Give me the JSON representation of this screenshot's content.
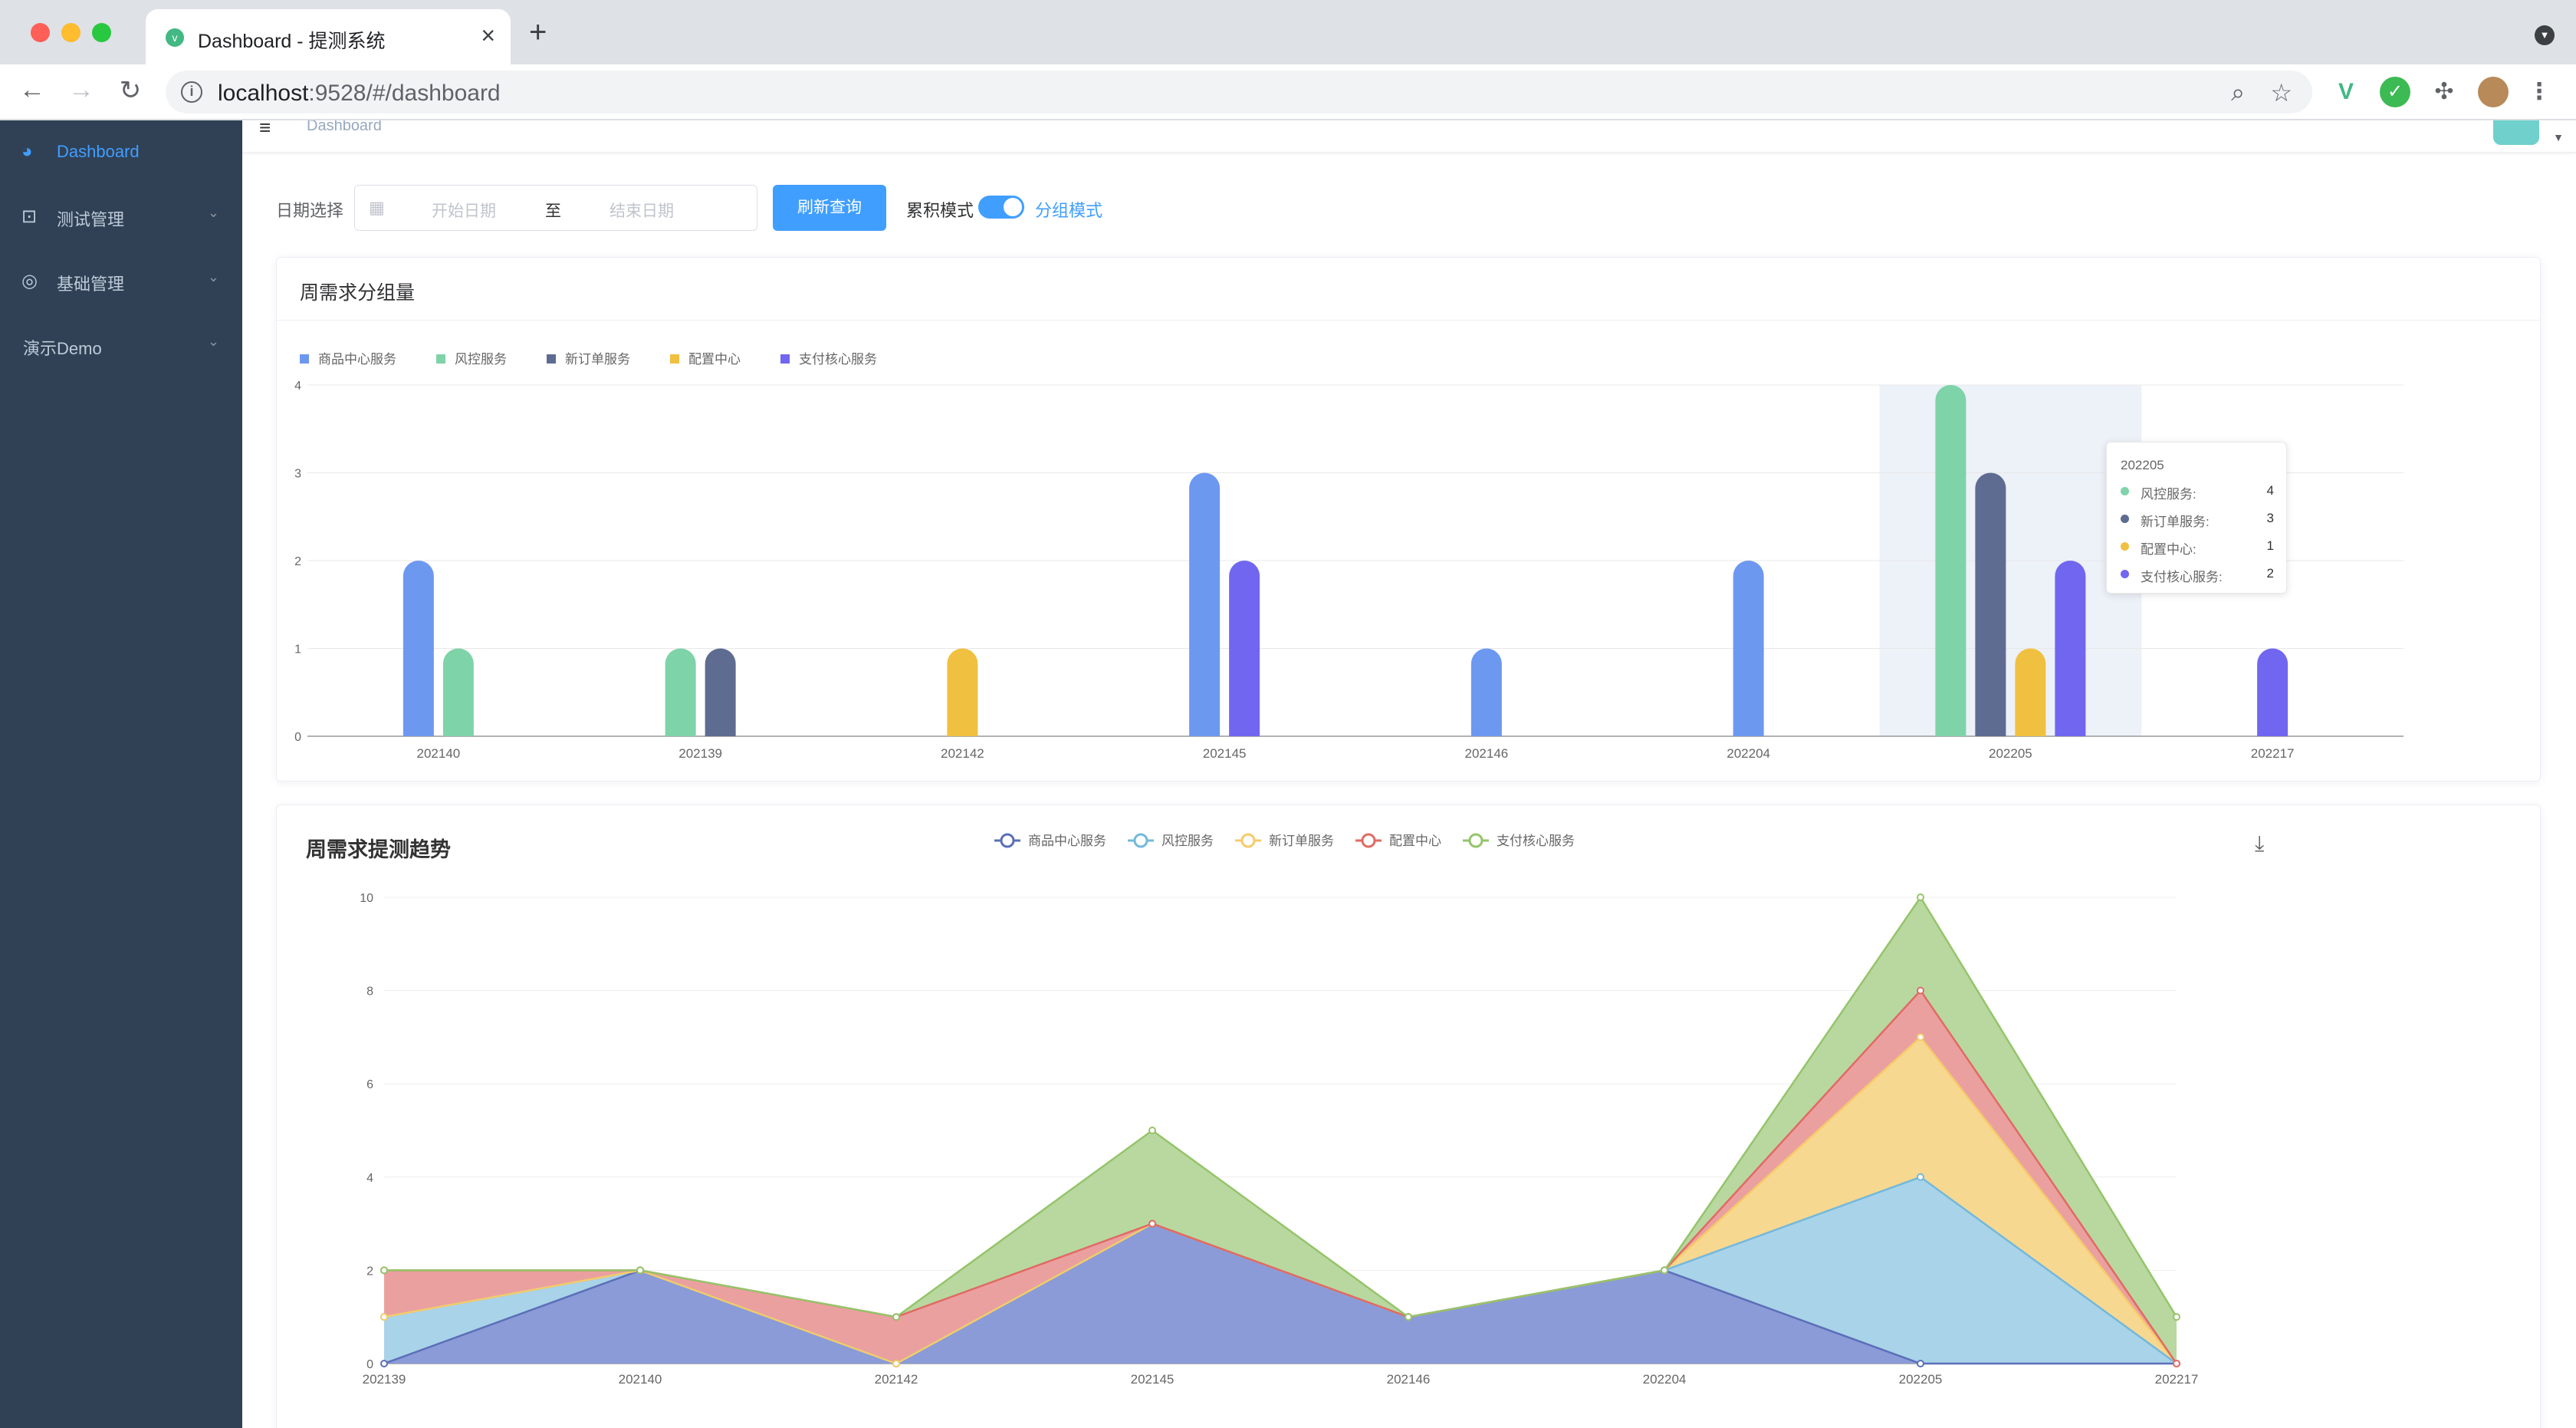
{
  "browser": {
    "tab_title": "Dashboard - 提测系统",
    "url_host": "localhost",
    "url_rest": ":9528/#/dashboard"
  },
  "sidebar": {
    "items": [
      {
        "label": "Dashboard",
        "icon": "dashboard-icon",
        "active": true
      },
      {
        "label": "测试管理",
        "icon": "chart-icon",
        "active": false
      },
      {
        "label": "基础管理",
        "icon": "settings-icon",
        "active": false
      },
      {
        "label": "演示Demo",
        "icon": "",
        "active": false
      }
    ]
  },
  "navbar": {
    "breadcrumb": "Dashboard"
  },
  "filters": {
    "date_label": "日期选择",
    "start_placeholder": "开始日期",
    "range_separator": "至",
    "end_placeholder": "结束日期",
    "refresh_button": "刷新查询",
    "mode_off_label": "累积模式",
    "mode_on_label": "分组模式",
    "grouped_mode_on": true
  },
  "colors": {
    "primary": "#409eff",
    "sidebar_bg": "#304156"
  },
  "card1": {
    "title": "周需求分组量"
  },
  "card2": {
    "title": "周需求提测趋势"
  },
  "tooltip": {
    "header": "202205",
    "rows": [
      {
        "name": "风控服务:",
        "value": "4",
        "color": "#7fd3a8"
      },
      {
        "name": "新订单服务:",
        "value": "3",
        "color": "#5e6c92"
      },
      {
        "name": "配置中心:",
        "value": "1",
        "color": "#f0c040"
      },
      {
        "name": "支付核心服务:",
        "value": "2",
        "color": "#7166f0"
      }
    ]
  },
  "chart_data": [
    {
      "type": "bar",
      "title": "周需求分组量",
      "categories": [
        "202140",
        "202139",
        "202142",
        "202145",
        "202146",
        "202204",
        "202205",
        "202217"
      ],
      "series": [
        {
          "name": "商品中心服务",
          "color": "#6d98f0",
          "values": [
            2,
            0,
            0,
            3,
            1,
            2,
            0,
            0
          ]
        },
        {
          "name": "风控服务",
          "color": "#7fd3a8",
          "values": [
            1,
            1,
            0,
            0,
            0,
            0,
            4,
            0
          ]
        },
        {
          "name": "新订单服务",
          "color": "#5e6c92",
          "values": [
            0,
            1,
            0,
            0,
            0,
            0,
            3,
            0
          ]
        },
        {
          "name": "配置中心",
          "color": "#f0c040",
          "values": [
            0,
            0,
            1,
            0,
            0,
            0,
            1,
            0
          ]
        },
        {
          "name": "支付核心服务",
          "color": "#7166f0",
          "values": [
            0,
            0,
            0,
            2,
            0,
            0,
            2,
            1
          ]
        }
      ],
      "ylim": [
        0,
        4
      ],
      "yticks": [
        "0",
        "1",
        "2",
        "3",
        "4"
      ],
      "highlight_category": "202205",
      "legend": "top-left"
    },
    {
      "type": "area",
      "title": "周需求提测趋势",
      "stacked": true,
      "categories": [
        "202139",
        "202140",
        "202142",
        "202145",
        "202146",
        "202204",
        "202205",
        "202217"
      ],
      "series": [
        {
          "name": "商品中心服务",
          "color": "#5b6fb8",
          "fill": "#8b9bd8",
          "values": [
            0,
            2,
            0,
            3,
            1,
            2,
            0,
            0
          ]
        },
        {
          "name": "风控服务",
          "color": "#73b8dc",
          "fill": "#a9d3e8",
          "values": [
            1,
            0,
            0,
            0,
            0,
            0,
            4,
            0
          ]
        },
        {
          "name": "新订单服务",
          "color": "#f6cb6a",
          "fill": "#f7d890",
          "values": [
            0,
            0,
            0,
            0,
            0,
            0,
            3,
            0
          ]
        },
        {
          "name": "配置中心",
          "color": "#e16a63",
          "fill": "#eba0a0",
          "values": [
            1,
            0,
            1,
            0,
            0,
            0,
            1,
            0
          ]
        },
        {
          "name": "支付核心服务",
          "color": "#95c46a",
          "fill": "#b8d8a0",
          "values": [
            0,
            0,
            0,
            2,
            0,
            0,
            2,
            1
          ]
        }
      ],
      "ylim": [
        0,
        10
      ],
      "yticks": [
        "0",
        "2",
        "4",
        "6",
        "8",
        "10"
      ],
      "legend": "top-center"
    }
  ]
}
